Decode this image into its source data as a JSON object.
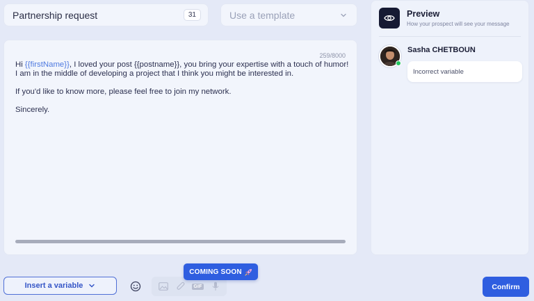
{
  "message_title": {
    "value": "Partnership request",
    "counter": "31"
  },
  "template_select": {
    "placeholder": "Use a template"
  },
  "editor": {
    "char_count": "259/8000",
    "line1": {
      "p1": "Hi ",
      "var1": "{{firstName}}",
      "p2": ", I loved your post {{postname}}, you bring your expertise with a touch of humor!"
    },
    "line2": "I am in the middle of developing a project that I think you might be interested in.",
    "line3": "If you'd like to know more, please feel free to join my network.",
    "line4": "Sincerely."
  },
  "preview": {
    "title": "Preview",
    "subtitle": "How your prospect will see your message",
    "prospect_name": "Sasha CHETBOUN",
    "bubble_text": "Incorrect variable"
  },
  "toolbar": {
    "insert_variable_label": "Insert a variable",
    "coming_soon_label": "COMING SOON",
    "coming_soon_icon": "rocket-icon",
    "gif_label": "GIF",
    "confirm_label": "Confirm"
  },
  "colors": {
    "accent": "#2f5ee0",
    "variable_text": "#4f7ae0",
    "online": "#22c55e",
    "background": "#e4e9f7"
  }
}
